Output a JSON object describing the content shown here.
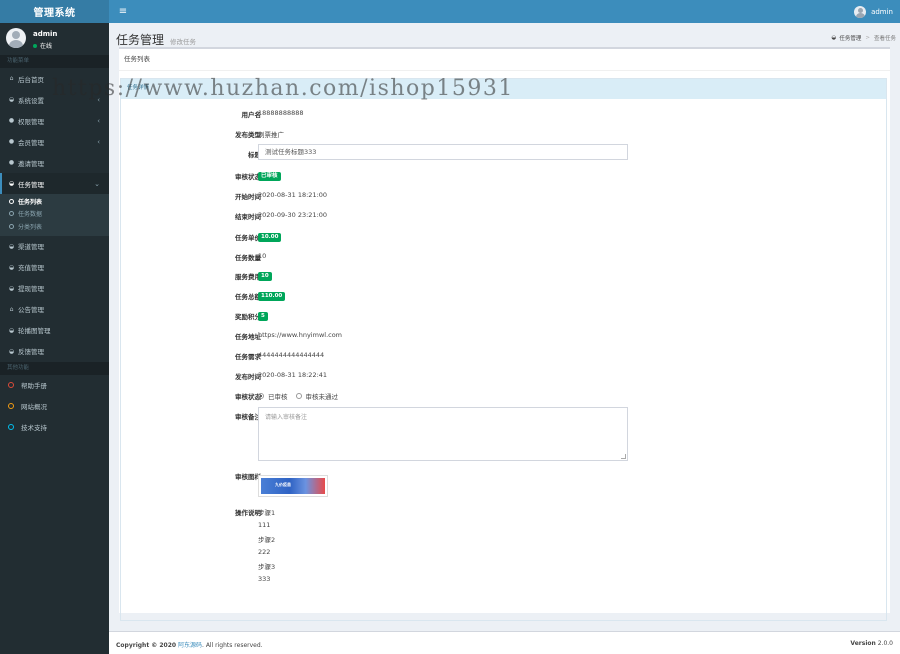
{
  "brand": "管理系统",
  "nav": {
    "username": "admin"
  },
  "sidebar": {
    "user": {
      "name": "admin",
      "status": "在线"
    },
    "header_main": "功能菜单",
    "items": [
      {
        "label": "后台首页",
        "icon": "home-icon",
        "arrow": false
      },
      {
        "label": "系统设置",
        "icon": "dashboard-icon",
        "arrow": true
      },
      {
        "label": "权限管理",
        "icon": "users-icon",
        "arrow": true
      },
      {
        "label": "会员管理",
        "icon": "users-icon",
        "arrow": true
      },
      {
        "label": "邀请管理",
        "icon": "users-icon",
        "arrow": false
      },
      {
        "label": "任务管理",
        "icon": "dashboard-icon",
        "arrow": true,
        "active": true
      }
    ],
    "submenu": [
      {
        "label": "任务列表",
        "active": true
      },
      {
        "label": "任务数据"
      },
      {
        "label": "分类列表"
      }
    ],
    "items2": [
      {
        "label": "渠道管理",
        "icon": "dashboard-icon"
      },
      {
        "label": "充值管理",
        "icon": "dashboard-icon"
      },
      {
        "label": "提现管理",
        "icon": "dashboard-icon"
      },
      {
        "label": "公告管理",
        "icon": "home-icon"
      },
      {
        "label": "轮播图管理",
        "icon": "dashboard-icon"
      },
      {
        "label": "反馈管理",
        "icon": "dashboard-icon"
      }
    ],
    "header_other": "其他功能",
    "other": [
      {
        "label": "帮助手册",
        "color": "#dd4b39"
      },
      {
        "label": "网站概况",
        "color": "#f39c12"
      },
      {
        "label": "技术支持",
        "color": "#00c0ef"
      }
    ]
  },
  "page": {
    "title": "任务管理",
    "subtitle": "修改任务",
    "breadcrumb": {
      "home": "任务管理",
      "current": "查看任务"
    }
  },
  "box": {
    "title": "任务列表",
    "inner_title": "任务详情"
  },
  "form": {
    "username": {
      "label": "用户名",
      "value": "18888888888"
    },
    "type": {
      "label": "发布类型",
      "value": "刷票推广"
    },
    "title": {
      "label": "标题",
      "value": "测试任务标题333"
    },
    "audit_status": {
      "label": "审核状态",
      "value": "已审核"
    },
    "start_time": {
      "label": "开始时间",
      "value": "2020-08-31 18:21:00"
    },
    "end_time": {
      "label": "结束时间",
      "value": "2020-09-30 23:21:00"
    },
    "unit_price": {
      "label": "任务单价",
      "value": "10.00"
    },
    "quantity": {
      "label": "任务数量",
      "value": "10"
    },
    "service_fee": {
      "label": "服务费用",
      "value": "10"
    },
    "total": {
      "label": "任务总额",
      "value": "110.00"
    },
    "points": {
      "label": "奖励积分",
      "value": "5"
    },
    "url": {
      "label": "任务地址",
      "value": "https://www.hnyimwl.com"
    },
    "requirement": {
      "label": "任务需求",
      "value": "4444444444444444"
    },
    "publish_time": {
      "label": "发布时间",
      "value": "2020-08-31 18:22:41"
    },
    "audit_radio": {
      "label": "审核状态",
      "option1": "已审核",
      "option2": "审核未通过"
    },
    "remark": {
      "label": "审核备注",
      "placeholder": "请输入审核备注"
    },
    "sample": {
      "label": "审核图样",
      "thumb_text": "九价疫苗"
    },
    "steps": {
      "label": "操作说明",
      "lines": [
        "步骤1",
        "111",
        "步骤2",
        "222",
        "步骤3",
        "333"
      ]
    }
  },
  "footer": {
    "copyright": "Copyright © 2020",
    "link": "阿东源码",
    "rights": ". All rights reserved.",
    "version_label": "Version",
    "version": "2.0.0"
  },
  "watermark": "https://www.huzhan.com/ishop15931"
}
